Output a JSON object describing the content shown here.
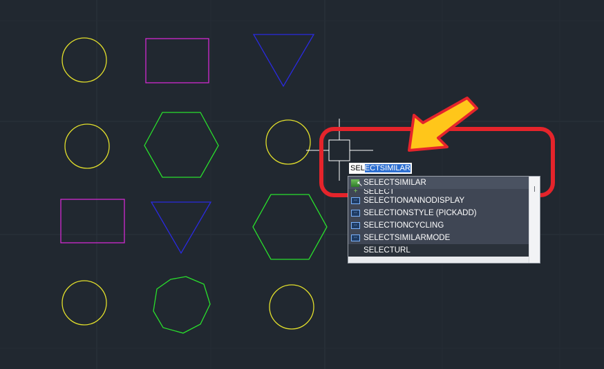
{
  "colors": {
    "background": "#212830",
    "grid": "#2b333d",
    "circle": "#e3e02b",
    "rectangle": "#d12ad1",
    "triangle": "#2a2ae0",
    "polygon": "#29e02c",
    "crosshair": "#ffffff",
    "annotation": "#e5242b",
    "arrow_fill": "#ffc61a"
  },
  "command_input": {
    "typed": "SEL",
    "autocomplete": "ECTSIMILAR"
  },
  "suggestions": [
    {
      "label": "SELECTSIMILAR",
      "icon": "command-icon"
    },
    {
      "label": "SELECT",
      "icon": "plus-icon"
    },
    {
      "label": "SELECTIONANNODISPLAY",
      "icon": "sysvar-icon"
    },
    {
      "label": "SELECTIONSTYLE (PICKADD)",
      "icon": "sysvar-icon"
    },
    {
      "label": "SELECTIONCYCLING",
      "icon": "sysvar-icon"
    },
    {
      "label": "SELECTSIMILARMODE",
      "icon": "sysvar-icon"
    },
    {
      "label": "SELECTURL",
      "icon": ""
    }
  ]
}
